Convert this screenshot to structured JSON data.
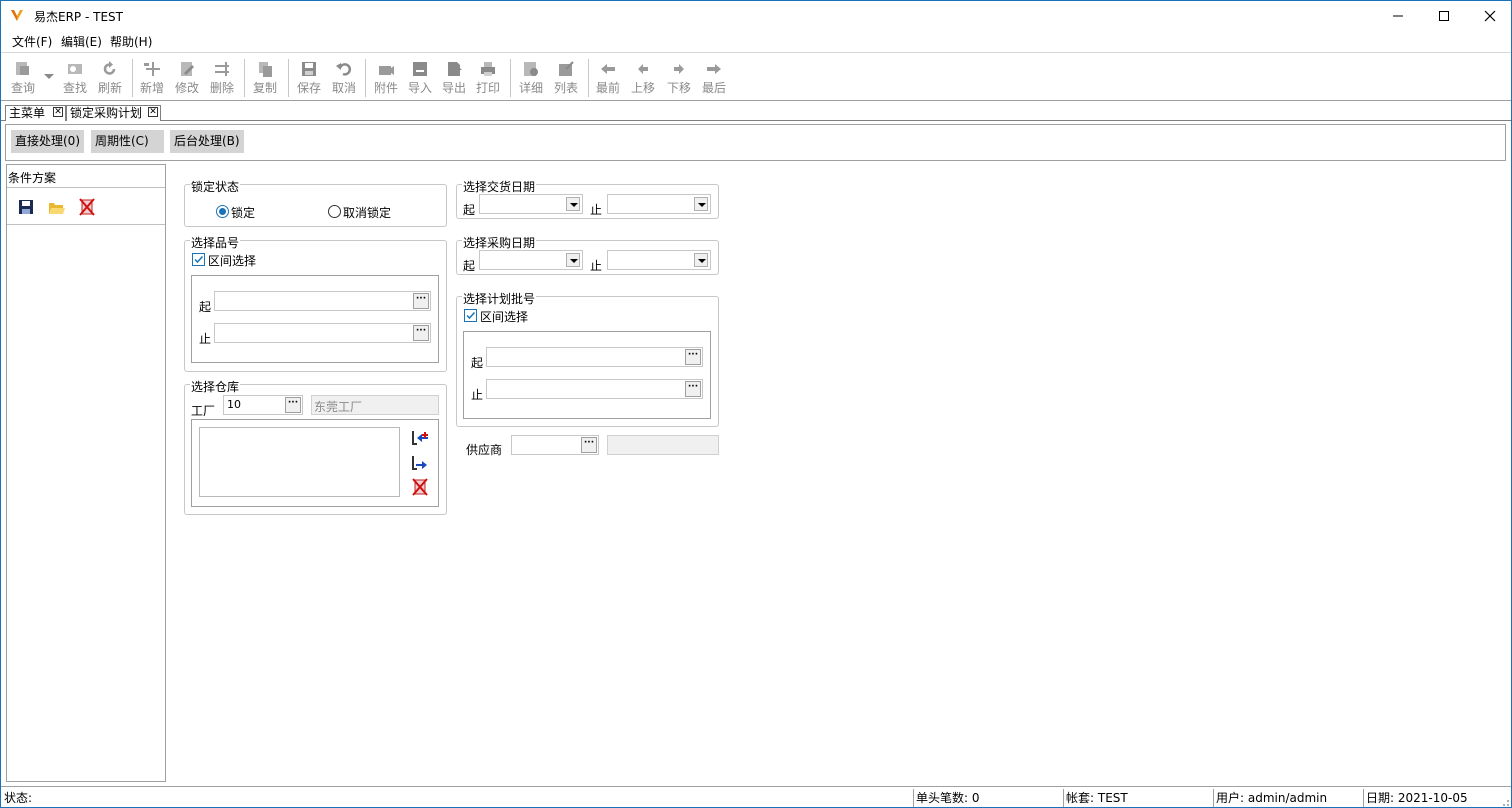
{
  "window": {
    "title": "易杰ERP - TEST"
  },
  "menu": [
    "文件(F)",
    "编辑(E)",
    "帮助(H)"
  ],
  "toolbar": {
    "query": "查询",
    "find": "查找",
    "refresh": "刷新",
    "add": "新增",
    "edit": "修改",
    "delete": "删除",
    "copy": "复制",
    "save": "保存",
    "cancel": "取消",
    "attach": "附件",
    "import": "导入",
    "export": "导出",
    "print": "打印",
    "detail": "详细",
    "list": "列表",
    "first": "最前",
    "prev": "上移",
    "next": "下移",
    "last": "最后"
  },
  "tabs": [
    {
      "label": "主菜单",
      "close": "✕"
    },
    {
      "label": "锁定采购计划",
      "close": "✕"
    }
  ],
  "actions": {
    "direct": "直接处理(0)",
    "periodic": "周期性(C)",
    "background": "后台处理(B)"
  },
  "left_panel": {
    "title": "条件方案"
  },
  "form": {
    "lock_status": {
      "title": "锁定状态",
      "lock": "锁定",
      "unlock": "取消锁定",
      "selected": "锁定"
    },
    "item_no": {
      "title": "选择品号",
      "range_label": "区间选择",
      "range_checked": true,
      "from": "起",
      "to": "止",
      "from_value": "",
      "to_value": ""
    },
    "warehouse": {
      "title": "选择仓库",
      "factory_label": "工厂",
      "factory_value": "10",
      "factory_name": "东莞工厂"
    },
    "delivery_date": {
      "title": "选择交货日期",
      "from": "起",
      "to": "止"
    },
    "purchase_date": {
      "title": "选择采购日期",
      "from": "起",
      "to": "止"
    },
    "plan_batch": {
      "title": "选择计划批号",
      "range_label": "区间选择",
      "range_checked": true,
      "from": "起",
      "to": "止"
    },
    "supplier": {
      "label": "供应商",
      "value": "",
      "name": ""
    },
    "ellipsis": "···"
  },
  "status": {
    "state": "状态:",
    "records": "单头笔数: 0",
    "account": "帐套: TEST",
    "user": "用户: admin/admin",
    "date": "日期: 2021-10-05"
  },
  "colors": {
    "accent": "#1a73b8",
    "button_bg": "#d4d4d4",
    "disabled_text": "#8a8a8a"
  }
}
